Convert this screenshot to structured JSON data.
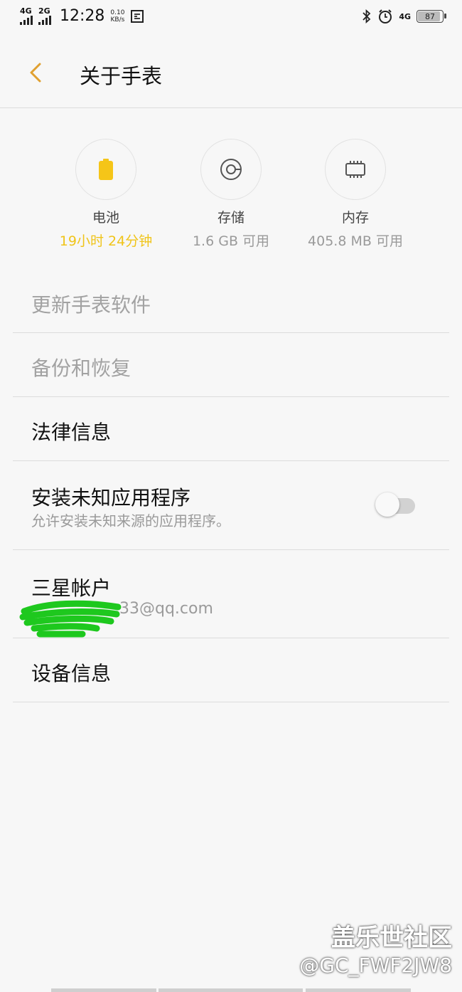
{
  "status_bar": {
    "signal1_label": "4G",
    "signal2_label": "2G",
    "time": "12:28",
    "speed_value": "0.10",
    "speed_unit": "KB/s",
    "network_right": "4G",
    "battery": "87",
    "battery_level": 0.87,
    "icons": [
      "bluetooth-icon",
      "alarm-icon",
      "screenshot-icon"
    ]
  },
  "header": {
    "title": "关于手表"
  },
  "stats": [
    {
      "icon": "battery-icon",
      "label": "电池",
      "value": "19小时 24分钟",
      "accent": "#f0c419"
    },
    {
      "icon": "storage-icon",
      "label": "存储",
      "value": "1.6 GB 可用"
    },
    {
      "icon": "memory-chip-icon",
      "label": "内存",
      "value": "405.8 MB 可用"
    }
  ],
  "list": {
    "update": "更新手表软件",
    "backup": "备份和恢复",
    "legal": "法律信息",
    "install_unknown": {
      "title": "安装未知应用程序",
      "subtitle": "允许安装未知来源的应用程序。",
      "enabled": false
    },
    "account": {
      "title": "三星帐户",
      "email_visible": "33@qq.com"
    },
    "device_info": "设备信息"
  },
  "watermark": {
    "line1": "盖乐世社区",
    "line2": "@GC_FWF2JW8"
  }
}
